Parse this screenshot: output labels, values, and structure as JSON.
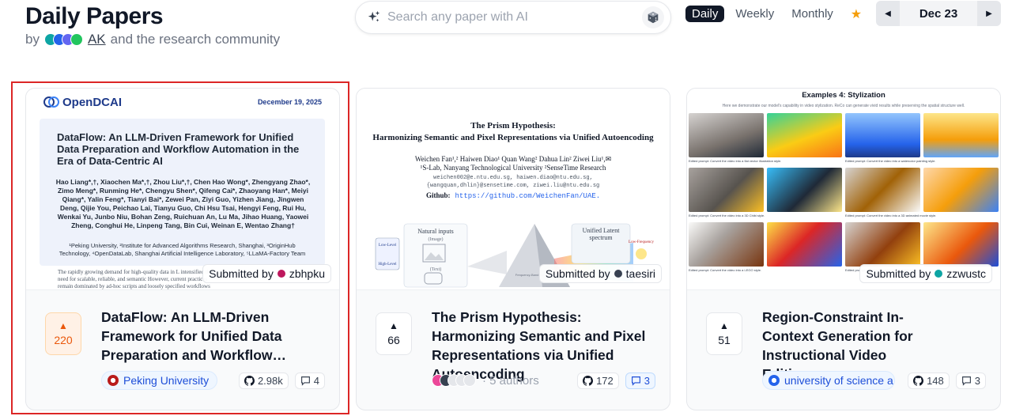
{
  "header": {
    "title": "Daily Papers",
    "by_prefix": "by",
    "ak_link": "AK",
    "by_suffix": "and the research community",
    "search_placeholder": "Search any paper with AI",
    "periods": [
      "Daily",
      "Weekly",
      "Monthly"
    ],
    "active_period": "Daily",
    "date": "Dec 23"
  },
  "colors": {
    "accent": "#ea580c",
    "highlight": "#dc2626",
    "link": "#1d4ed8"
  },
  "papers": [
    {
      "title": "DataFlow: An LLM-Driven Framework for Unified Data Preparation and Workflow…",
      "upvotes": "220",
      "submitted_label": "Submitted by",
      "submitter": "zbhpku",
      "org": "Peking University",
      "github_stars": "2.98k",
      "comments": "4",
      "thumb": {
        "logo": "OpenDCAI",
        "date": "December 19, 2025",
        "title": "DataFlow: An LLM-Driven Framework for Unified Data Preparation and Workflow Automation in the Era of Data-Centric AI",
        "authors": "Hao Liang*,†, Xiaochen Ma*,†, Zhou Liu*,†, Chen Hao Wong*, Zhengyang Zhao*, Zimo Meng*, Runming He*, Chengyu Shen*, Qifeng Cai*, Zhaoyang Han*, Meiyi Qiang*, Yalin Feng*, Tianyi Bai*, Zewei Pan, Ziyi Guo, Yizhen Jiang, Jingwen Deng, Qijie You, Peichao Lai, Tianyu Guo, Chi Hsu Tsai, Hengyi Feng, Rui Hu, Wenkai Yu, Junbo Niu, Bohan Zeng, Ruichuan An, Lu Ma, Jihao Huang, Yaowei Zheng, Conghui He, Linpeng Tang, Bin Cui, Weinan E, Wentao Zhang†",
        "affiliations": "¹Peking University, ²Institute for Advanced Algorithms Research, Shanghai, ³OriginHub Technology, ⁴OpenDataLab, Shanghai Artificial Intelligence Laboratory, ⁵LLaMA-Factory Team",
        "abstract": "The rapidly growing demand for high-quality data in L intensified the need for scalable, reliable, and semantic However, current practices remain dominated by ad-hoc scripts and loosely specified workflows"
      }
    },
    {
      "title": "The Prism Hypothesis: Harmonizing Semantic and Pixel Representations via Unified Autoencoding",
      "upvotes": "66",
      "submitted_label": "Submitted by",
      "submitter": "taesiri",
      "authors_text": "· 5 authors",
      "github_stars": "172",
      "comments": "3",
      "thumb": {
        "title_line1": "The Prism Hypothesis:",
        "title_line2": "Harmonizing Semantic and Pixel Representations via Unified Autoencoding",
        "authors": "Weichen Fan¹,²  Haiwen Diao¹  Quan Wang²  Dahua Lin²  Ziwei Liu¹,✉",
        "affil": "¹S-Lab, Nanyang Technological University  ²SenseTime Research",
        "emails1": "weichen002@e.ntu.edu.sg,  haiwen.diao@ntu.edu.sg,",
        "emails2": "{wangquan,dhlin}@sensetime.com,  ziwei.liu@ntu.edu.sg",
        "github_label": "Github:",
        "github_url": "https://github.com/WeichenFan/UAE.",
        "fig_natural": "Natural inputs",
        "fig_image": "(Image)",
        "fig_text": "(Text)",
        "fig_latent1": "Unified Latent",
        "fig_latent2": "spectrum",
        "fig_low": "Low-Level",
        "fig_high": "High-Level",
        "fig_lowfreq": "Low-Frequency",
        "fig_center": "Frequency-Band Modulator"
      }
    },
    {
      "title": "Region-Constraint In-Context Generation for Instructional Video Editing",
      "upvotes": "51",
      "submitted_label": "Submitted by",
      "submitter": "zzwustc",
      "org": "university of science a…",
      "github_stars": "148",
      "comments": "3",
      "thumb": {
        "heading": "Examples 4: Stylization",
        "sub": "Here we demonstrate our model's capability in video stylization. ReCo can generate vivid results while preserving the spatial structure well.",
        "captions": [
          [
            "Edited prompt: Convert the video into a flat vector illustration style.",
            "Edited prompt: Convert the video into a watercolor painting style."
          ],
          [
            "Edited prompt: Convert the video into a 3D Chibi style.",
            "Edited prompt: Convert the video into a 3D animated movie style."
          ],
          [
            "Edited prompt: Convert the video into a LEGO style.",
            "Edited prompt: Convert the video into a comic book style."
          ]
        ]
      }
    }
  ]
}
